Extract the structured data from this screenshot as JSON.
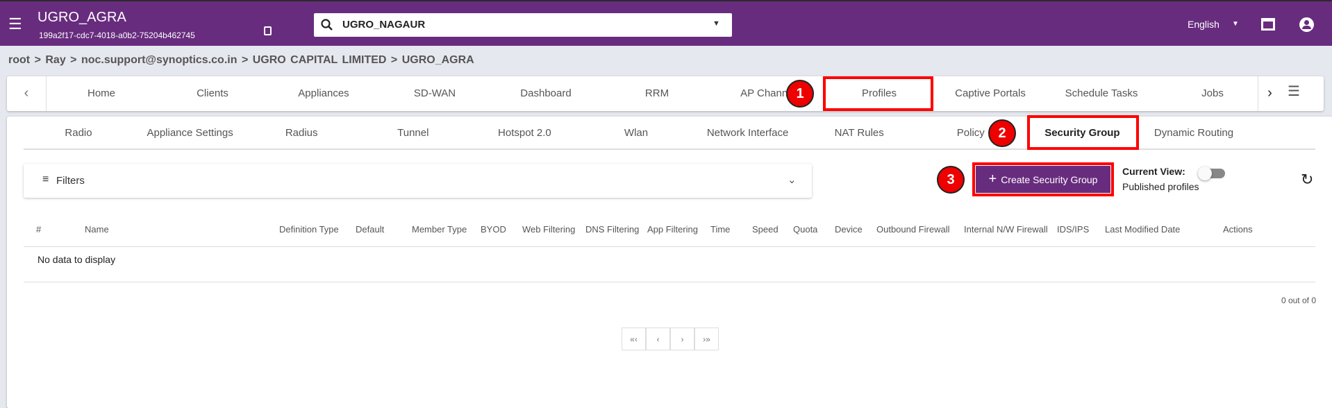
{
  "header": {
    "title": "UGRO_AGRA",
    "id": "199a2f17-cdc7-4018-a0b2-75204b462745",
    "search_value": "UGRO_NAGAUR",
    "language": "English"
  },
  "breadcrumb": [
    "root",
    ">",
    "Ray",
    ">",
    "noc.support@synoptics.co.in",
    ">",
    "UGRO CAPITAL LIMITED",
    ">",
    "UGRO_AGRA"
  ],
  "nav": [
    "Home",
    "Clients",
    "Appliances",
    "SD-WAN",
    "Dashboard",
    "RRM",
    "AP Channel",
    "Profiles",
    "Captive Portals",
    "Schedule Tasks",
    "Jobs"
  ],
  "subtabs": [
    "Radio",
    "Appliance Settings",
    "Radius",
    "Tunnel",
    "Hotspot 2.0",
    "Wlan",
    "Network Interface",
    "NAT Rules",
    "Policy",
    "Security Group",
    "Dynamic Routing"
  ],
  "badges": [
    "1",
    "2",
    "3"
  ],
  "filters_label": "Filters",
  "create_button": "Create Security Group",
  "current_view_label": "Current View:",
  "current_view_value": "Published profiles",
  "table": {
    "columns": [
      "#",
      "Name",
      "Definition Type",
      "Default",
      "Member Type",
      "BYOD",
      "Web Filtering",
      "DNS Filtering",
      "App Filtering",
      "Time",
      "Speed",
      "Quota",
      "Device",
      "Outbound Firewall",
      "Internal N/W Firewall",
      "IDS/IPS",
      "Last Modified Date",
      "Actions"
    ],
    "empty": "No data to display",
    "count": "0 out of 0"
  },
  "pagination": [
    "«‹",
    "‹",
    "›",
    "›»"
  ]
}
